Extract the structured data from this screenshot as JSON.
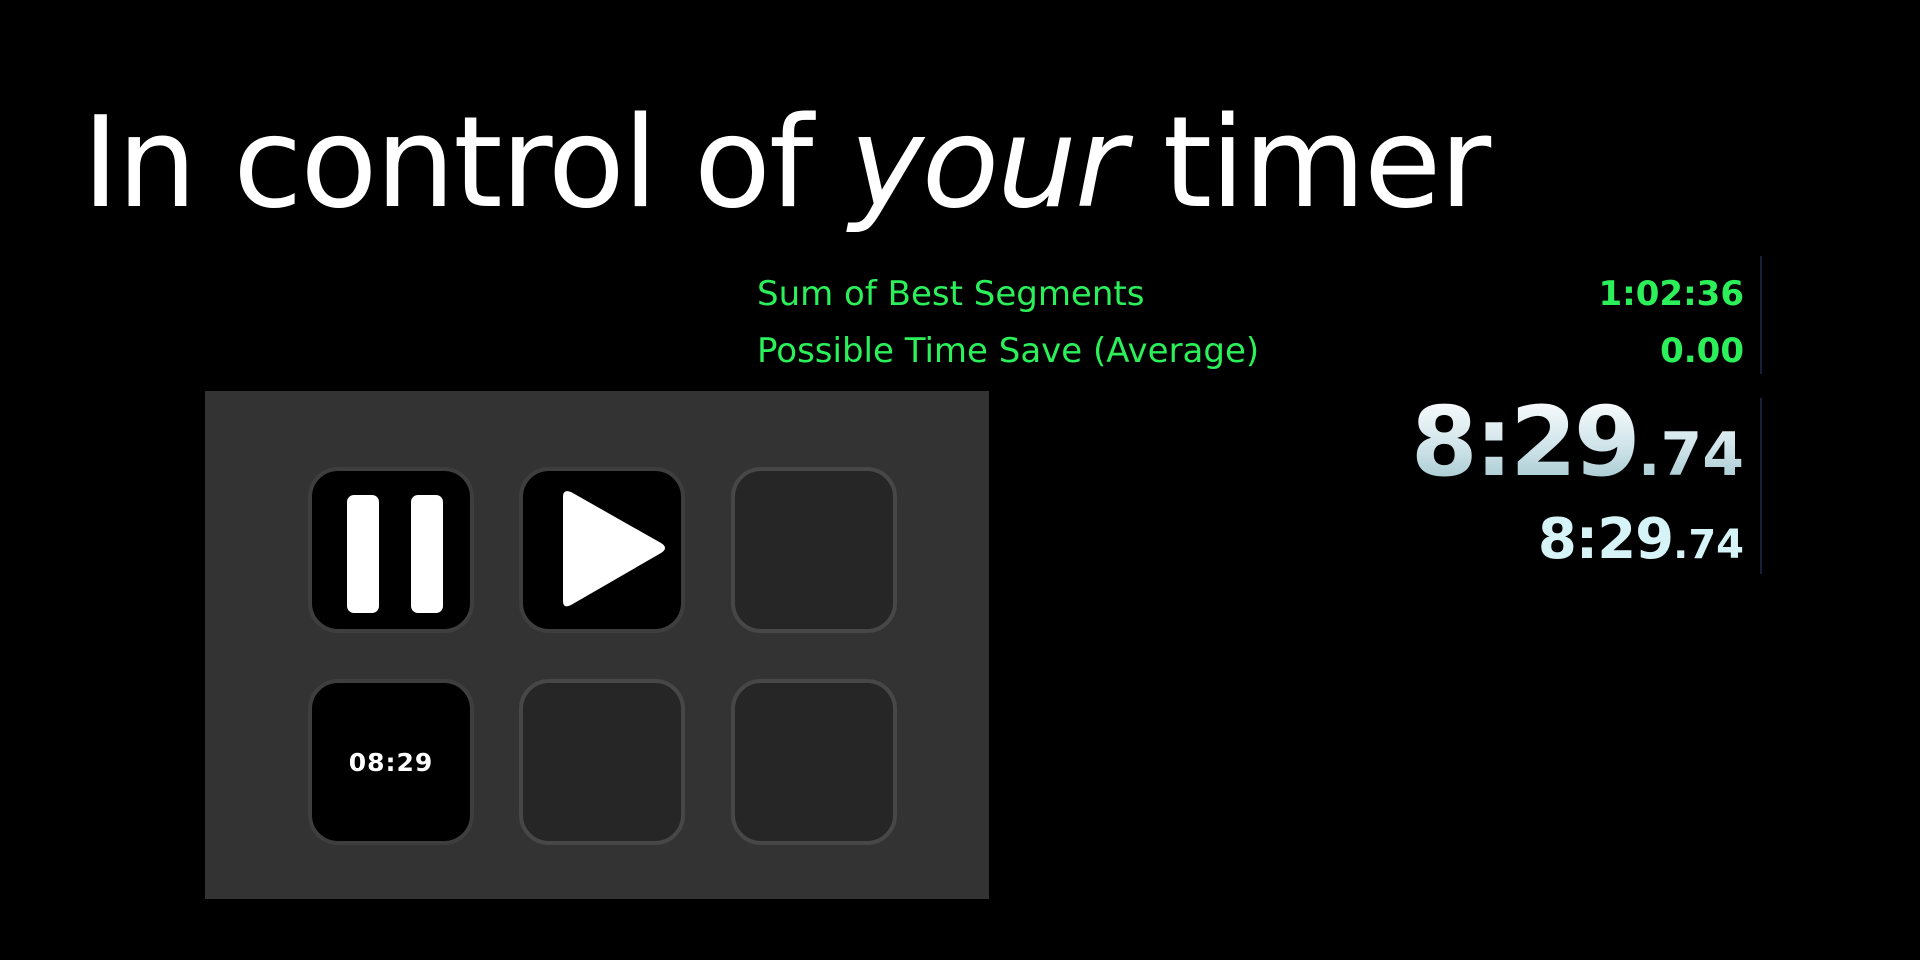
{
  "headline": {
    "before": "In control of ",
    "emphasis": "your",
    "after": " timer"
  },
  "timer": {
    "stats": [
      {
        "label": "Sum of Best Segments",
        "value": "1:02:36"
      },
      {
        "label": "Possible Time Save (Average)",
        "value": "0.00"
      }
    ],
    "main": {
      "whole": "8:29",
      "fraction": ".74"
    },
    "segment": {
      "whole": "8:29",
      "fraction": ".74"
    },
    "colors": {
      "stats_text": "#2cf05a",
      "timer_text": "#dcecef",
      "background": "#000000"
    }
  },
  "deck": {
    "keys": [
      {
        "icon": "pause-icon"
      },
      {
        "icon": "play-icon"
      },
      {
        "icon": "empty"
      },
      {
        "icon": "time-display",
        "label": "08:29"
      },
      {
        "icon": "empty"
      },
      {
        "icon": "empty"
      }
    ],
    "colors": {
      "panel": "#333333",
      "key_empty": "#262626",
      "key_active": "#000000"
    }
  }
}
